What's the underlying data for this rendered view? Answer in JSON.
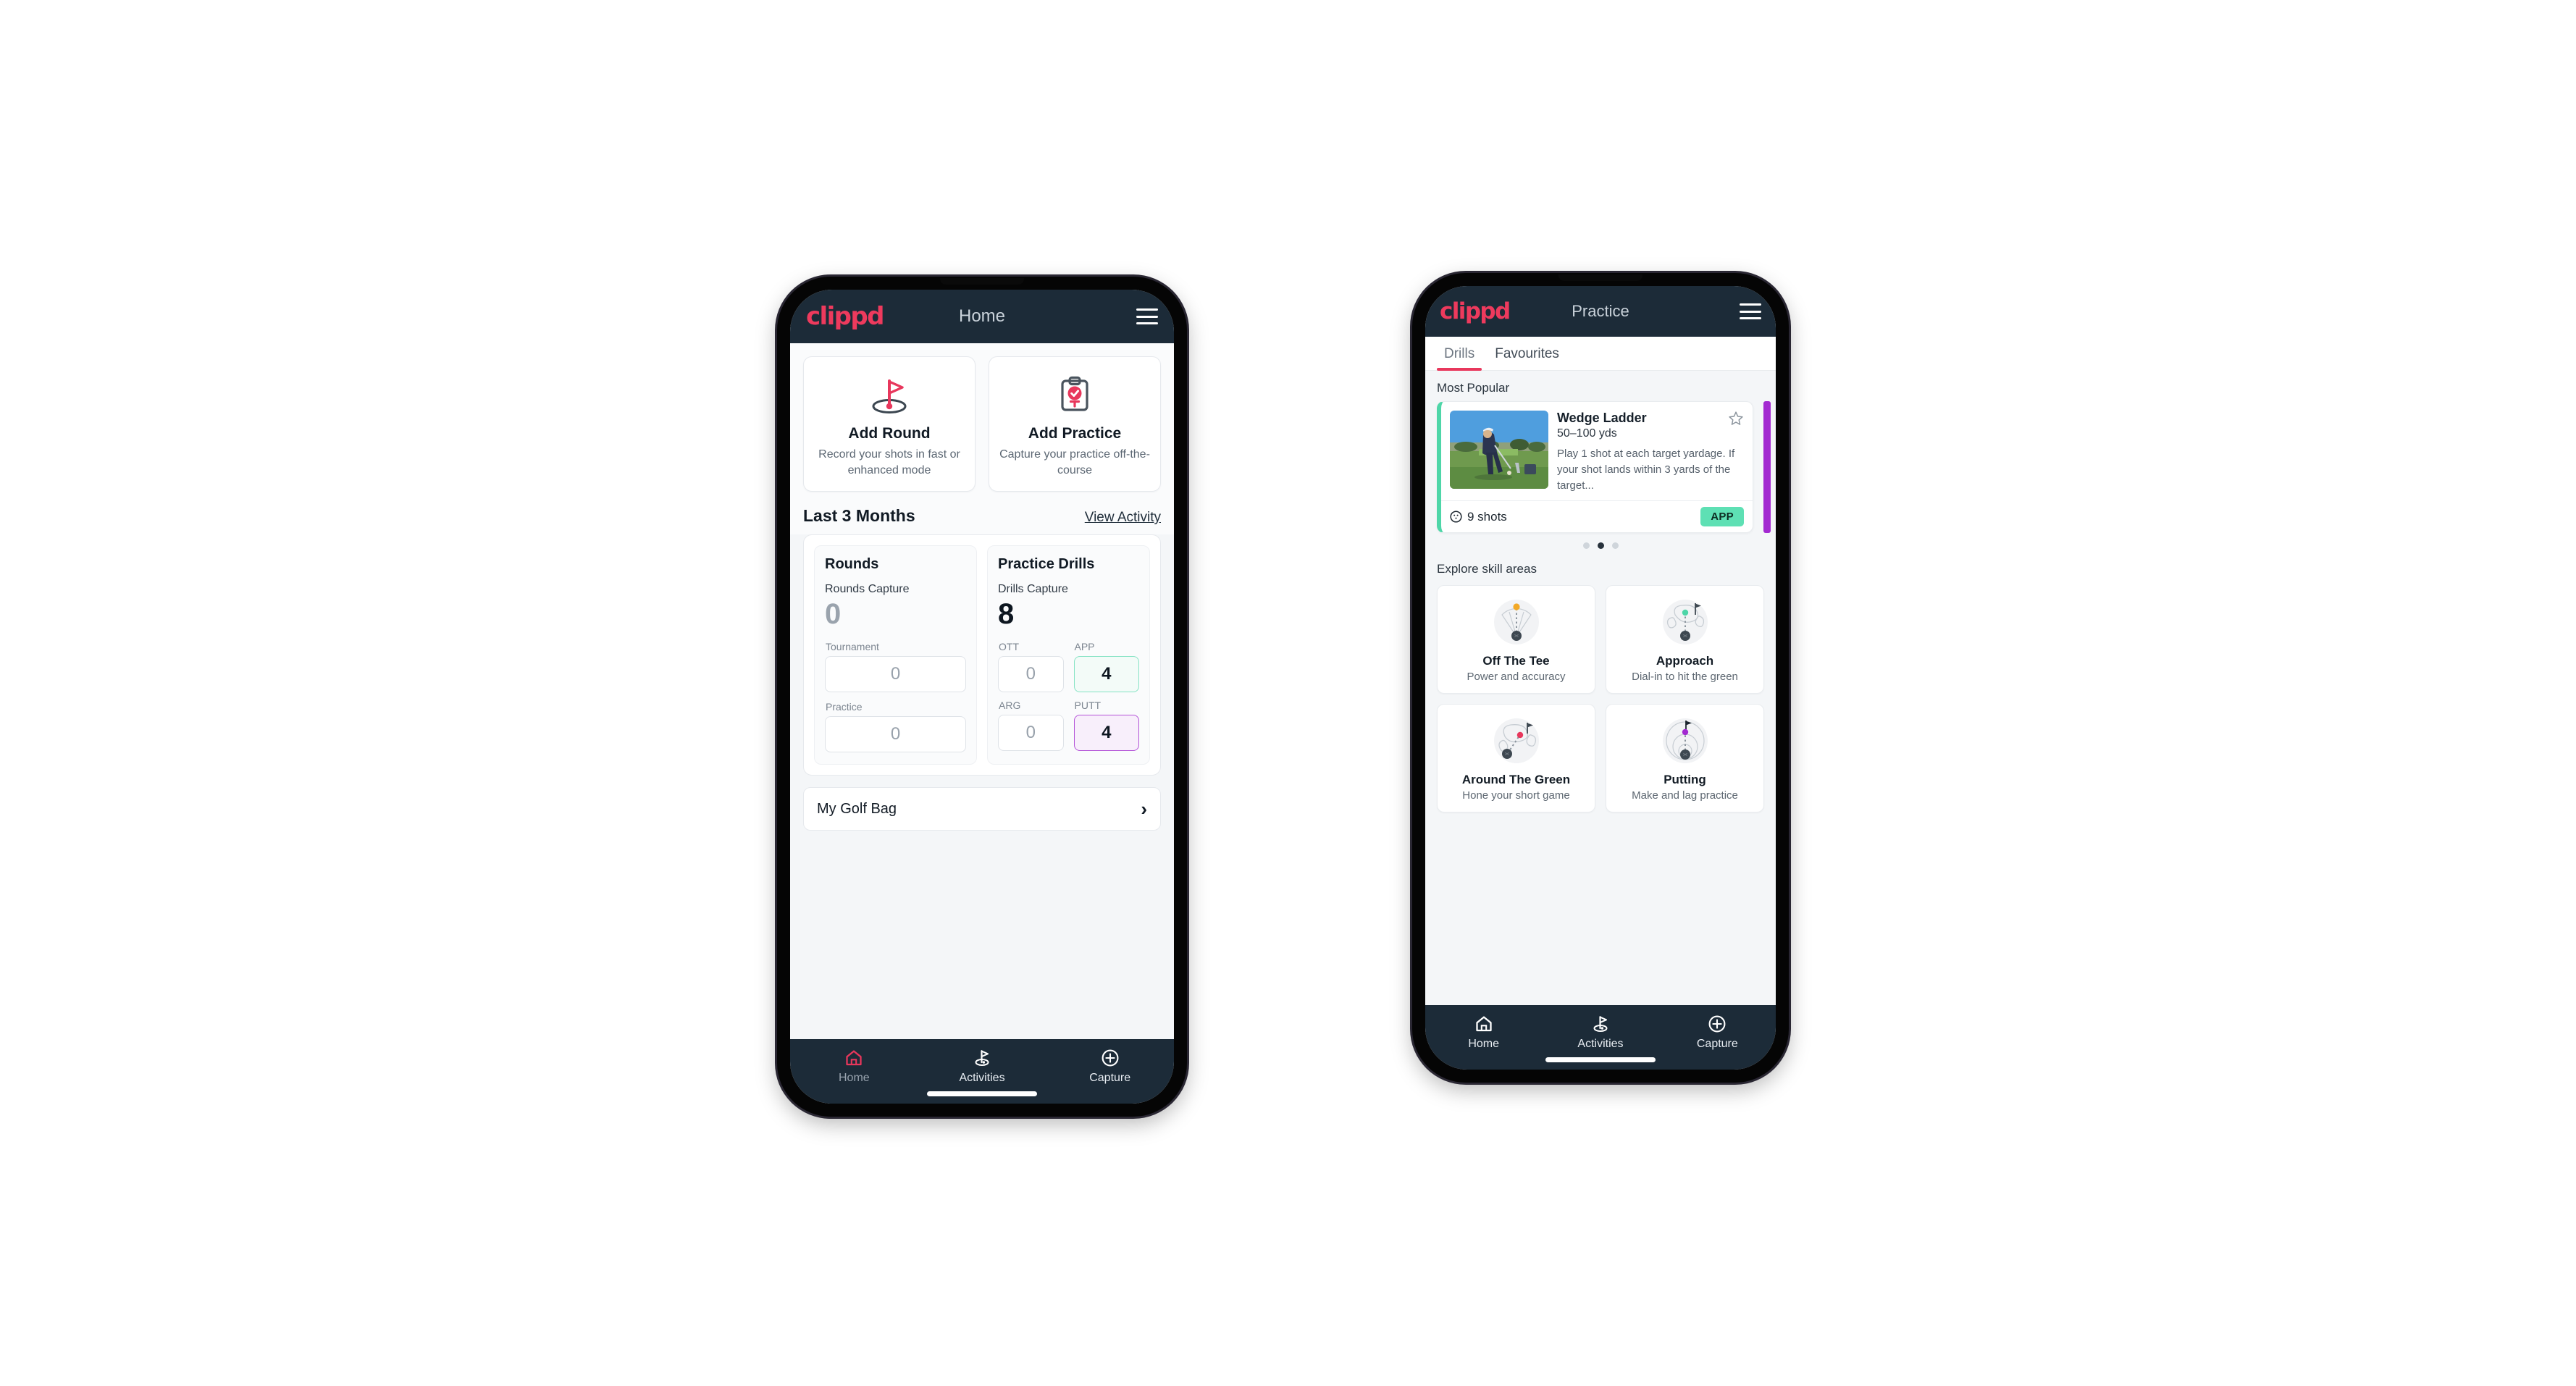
{
  "colors": {
    "brand_pink": "#ee3a5d",
    "appbar_dark": "#1c2b38",
    "accent_green": "#5ee0b4",
    "accent_purple": "#a32ad1",
    "tab_underline": "#e8375c"
  },
  "home": {
    "appbar": {
      "logo": "clippd",
      "title": "Home",
      "menu_icon": "hamburger-icon"
    },
    "quick_actions": [
      {
        "icon": "golf-flag-hole-icon",
        "title": "Add Round",
        "subtitle": "Record your shots in fast or enhanced mode"
      },
      {
        "icon": "clipboard-check-tee-icon",
        "title": "Add Practice",
        "subtitle": "Capture your practice off-the-course"
      }
    ],
    "section": {
      "title": "Last 3 Months",
      "link": "View Activity"
    },
    "rounds": {
      "heading": "Rounds",
      "capture_label": "Rounds Capture",
      "capture_value": "0",
      "fields": [
        {
          "label": "Tournament",
          "value": "0"
        },
        {
          "label": "Practice",
          "value": "0"
        }
      ]
    },
    "drills": {
      "heading": "Practice Drills",
      "capture_label": "Drills Capture",
      "capture_value": "8",
      "fields": [
        {
          "label": "OTT",
          "value": "0",
          "accent": "none"
        },
        {
          "label": "APP",
          "value": "4",
          "accent": "green"
        },
        {
          "label": "ARG",
          "value": "0",
          "accent": "none"
        },
        {
          "label": "PUTT",
          "value": "4",
          "accent": "purple"
        }
      ]
    },
    "golf_bag": {
      "label": "My Golf Bag",
      "chevron": "chevron-right-icon"
    },
    "bottom_nav": [
      {
        "icon": "home-icon",
        "label": "Home",
        "active": true
      },
      {
        "icon": "golf-flag-icon",
        "label": "Activities",
        "active": false
      },
      {
        "icon": "plus-circle-icon",
        "label": "Capture",
        "active": false
      }
    ]
  },
  "practice": {
    "appbar": {
      "logo": "clippd",
      "title": "Practice",
      "menu_icon": "hamburger-icon"
    },
    "tabs": [
      {
        "label": "Drills",
        "active": true
      },
      {
        "label": "Favourites",
        "active": false
      }
    ],
    "most_popular_label": "Most Popular",
    "drill_card": {
      "name": "Wedge Ladder",
      "yardage": "50–100 yds",
      "description": "Play 1 shot at each target yardage. If your shot lands within 3 yards of the target...",
      "shots": "9 shots",
      "shots_icon": "golf-ball-icon",
      "badge": "APP",
      "favourite_icon": "star-outline-icon",
      "thumbnail": "golfer-chipping-photo"
    },
    "carousel_dots": {
      "count": 3,
      "active_index": 1
    },
    "skill_section_label": "Explore skill areas",
    "skill_areas": [
      {
        "icon": "tee-shot-dispersion-icon",
        "name": "Off The Tee",
        "subtitle": "Power and accuracy"
      },
      {
        "icon": "approach-green-icon",
        "name": "Approach",
        "subtitle": "Dial-in to hit the green"
      },
      {
        "icon": "chip-around-green-icon",
        "name": "Around The Green",
        "subtitle": "Hone your short game"
      },
      {
        "icon": "putting-rings-icon",
        "name": "Putting",
        "subtitle": "Make and lag practice"
      }
    ],
    "bottom_nav": [
      {
        "icon": "home-icon",
        "label": "Home",
        "active": false
      },
      {
        "icon": "golf-flag-icon",
        "label": "Activities",
        "active": true
      },
      {
        "icon": "plus-circle-icon",
        "label": "Capture",
        "active": false
      }
    ]
  }
}
